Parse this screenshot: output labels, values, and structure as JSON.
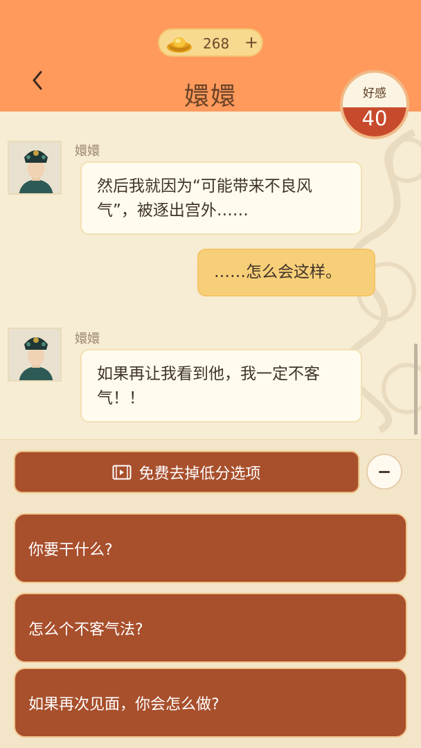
{
  "header": {
    "coins": "268",
    "coins_plus": "+",
    "title": "嬛嬛",
    "affinity_label": "好感",
    "affinity_value": "40"
  },
  "messages": [
    {
      "from": "npc",
      "sender": "嬛嬛",
      "text": "然后我就因为“可能带来不良风气”，被逐出宫外……"
    },
    {
      "from": "me",
      "text": "……怎么会这样。"
    },
    {
      "from": "npc",
      "sender": "嬛嬛",
      "text": "如果再让我看到他，我一定不客气！！"
    }
  ],
  "panel": {
    "free_button_label": "免费去掉低分选项",
    "options": [
      "你要干什么?",
      "怎么个不客气法?",
      "如果再次见面，你会怎么做?"
    ]
  },
  "icons": {
    "coin": "gold-ingot-icon",
    "back": "chevron-left-icon",
    "video": "video-icon",
    "collapse": "minus-icon"
  },
  "colors": {
    "header": "#ff9a5c",
    "accent": "#a84f2c",
    "affinity_fill": "#c84a2c",
    "my_bubble": "#f7cf78"
  }
}
